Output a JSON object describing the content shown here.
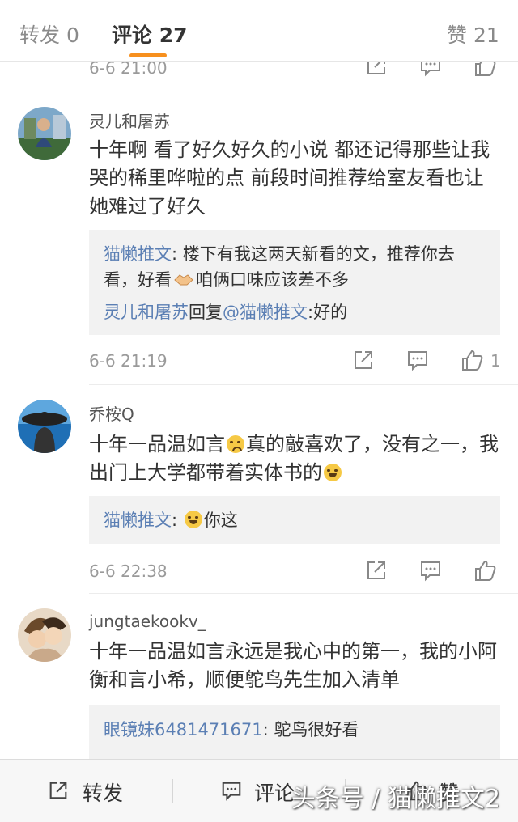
{
  "tabs": {
    "repost": "转发 0",
    "comments": "评论 27",
    "likes": "赞 21"
  },
  "top_partial": {
    "time": "6-6 21:00"
  },
  "comments": [
    {
      "user": "灵儿和屠苏",
      "text": "十年啊 看了好久好久的小说 都还记得那些让我哭的稀里哗啦的点 前段时间推荐给室友看也让她难过了好久",
      "replies": [
        {
          "nick": "猫懒推文",
          "text_a": ": 楼下有我这两天新看的文，推荐你去看，好看",
          "emoji": "handshake",
          "text_b": "咱俩口味应该差不多"
        },
        {
          "nick": "灵儿和屠苏",
          "mid": "回复",
          "nick2": "@猫懒推文",
          "text": ":好的"
        }
      ],
      "time": "6-6 21:19",
      "like_count": "1"
    },
    {
      "user": "乔桉Q",
      "text_a": "十年一品温如言",
      "emoji_a": "crying-face",
      "text_b": "真的敲喜欢了，没有之一，我出门上大学都带着实体书的",
      "emoji_b": "laughing-face",
      "replies": [
        {
          "nick": "猫懒推文",
          "text_a": ": ",
          "emoji": "laughing-face",
          "text_b": "你这"
        }
      ],
      "time": "6-6 22:38"
    },
    {
      "user": "jungtaekookv_",
      "text": "十年一品温如言永远是我心中的第一，我的小阿衡和言小希，顺便鸵鸟先生加入清单",
      "replies": [
        {
          "nick": "眼镜妹6481471671",
          "text": ": 鸵鸟很好看"
        }
      ]
    }
  ],
  "bottom_bar": {
    "repost": "转发",
    "comment": "评论",
    "like": "赞"
  },
  "watermark": "头条号 / 猫懒推文2",
  "colors": {
    "accent": "#f7901e",
    "link": "#5b7fb4",
    "reply_bg": "#f2f2f2"
  }
}
